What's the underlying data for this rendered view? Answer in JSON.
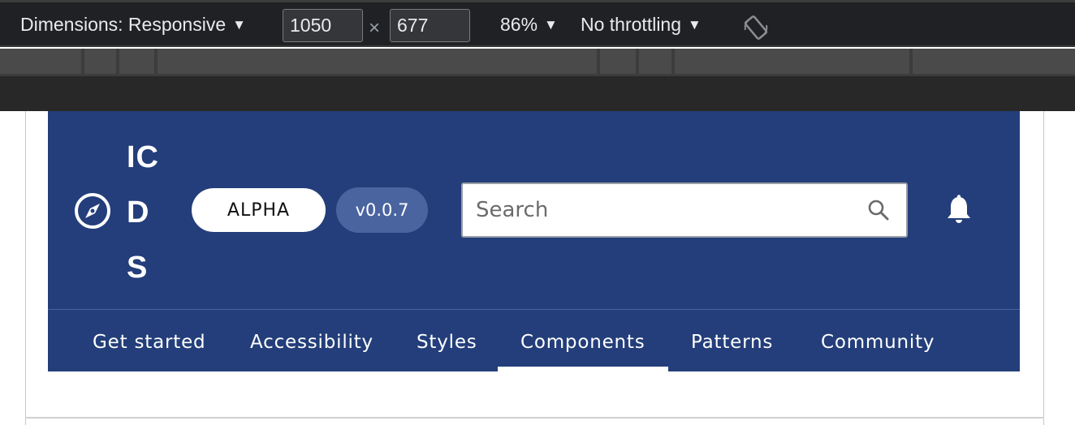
{
  "devtools": {
    "dimensions_label": "Dimensions: Responsive",
    "width_value": "1050",
    "times_symbol": "×",
    "height_value": "677",
    "zoom_label": "86%",
    "throttling_label": "No throttling",
    "caret": "▼"
  },
  "site": {
    "logo_text": "ICDS",
    "badge_alpha": "ALPHA",
    "badge_version": "v0.0.7",
    "search_placeholder": "Search",
    "nav": [
      {
        "label": "Get started"
      },
      {
        "label": "Accessibility"
      },
      {
        "label": "Styles"
      },
      {
        "label": "Components",
        "active": true
      },
      {
        "label": "Patterns"
      },
      {
        "label": "Community"
      }
    ]
  },
  "colors": {
    "brand": "#233e7a",
    "version_badge": "#4a64a0",
    "devtools_bg": "#202124"
  },
  "icons": [
    "compass-icon",
    "search-icon",
    "bell-icon",
    "rotate-icon"
  ]
}
